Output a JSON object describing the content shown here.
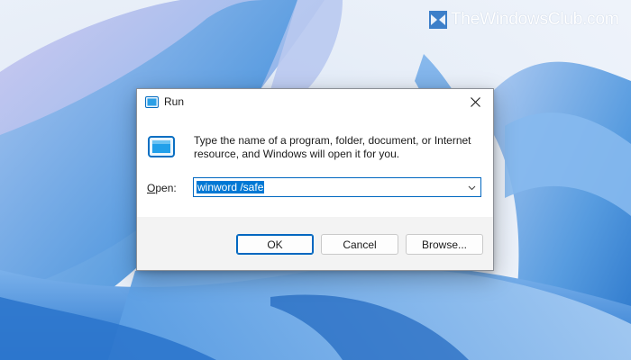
{
  "watermark": {
    "text": "TheWindowsClub.com"
  },
  "dialog": {
    "title": "Run",
    "description": "Type the name of a program, folder, document, or Internet resource, and Windows will open it for you.",
    "open_label_mnemonic": "O",
    "open_label_rest": "pen:",
    "open_value": "winword /safe",
    "buttons": {
      "ok": "OK",
      "cancel": "Cancel",
      "browse": "Browse..."
    }
  },
  "colors": {
    "accent": "#0067c0",
    "selection": "#0078d4",
    "dialog_bg": "#f3f3f3",
    "wallpaper_blue": "#3f8fd8"
  },
  "icons": {
    "title": "run-icon",
    "close": "close-icon",
    "chevron": "chevron-down-icon",
    "logo": "windows-club-logo"
  }
}
